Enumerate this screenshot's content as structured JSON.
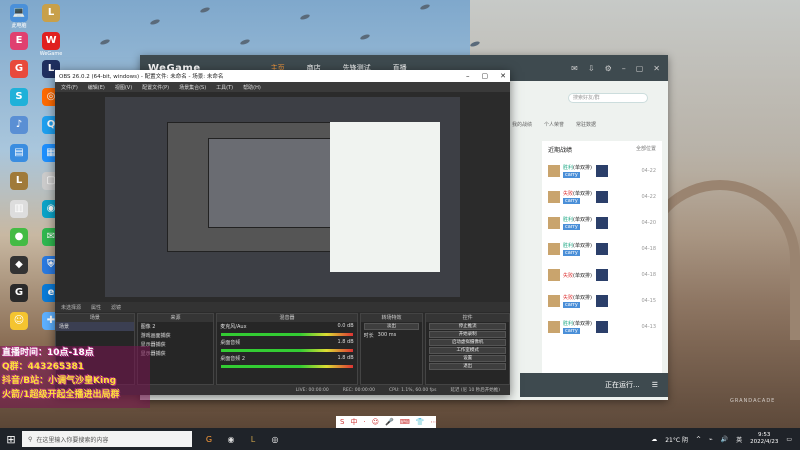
{
  "desktop": {
    "icons": [
      {
        "label": "此电脑",
        "glyph": "💻",
        "color": "#4a90d9"
      },
      {
        "label": "",
        "glyph": "E",
        "color": "#e04070"
      },
      {
        "label": "",
        "glyph": "G",
        "color": "#e84a3b"
      },
      {
        "label": "",
        "glyph": "S",
        "color": "#1fb1d9"
      },
      {
        "label": "",
        "glyph": "♪",
        "color": "#5a8fd4"
      },
      {
        "label": "",
        "glyph": "▤",
        "color": "#3a8de0"
      },
      {
        "label": "",
        "glyph": "L",
        "color": "#a07a3a"
      },
      {
        "label": "",
        "glyph": "▥",
        "color": "#ddd"
      },
      {
        "label": "",
        "glyph": "●",
        "color": "#44bb44"
      },
      {
        "label": "",
        "glyph": "◆",
        "color": "#333"
      },
      {
        "label": "",
        "glyph": "G",
        "color": "#2a2a2a"
      },
      {
        "label": "",
        "glyph": "☺",
        "color": "#f4c430"
      },
      {
        "label": "",
        "glyph": "L",
        "color": "#c8a04a"
      },
      {
        "label": "WeGame",
        "glyph": "W",
        "color": "#e02020"
      },
      {
        "label": "",
        "glyph": "L",
        "color": "#203060"
      },
      {
        "label": "",
        "glyph": "◎",
        "color": "#ff6a00"
      },
      {
        "label": "",
        "glyph": "Q",
        "color": "#1ea0f0"
      },
      {
        "label": "",
        "glyph": "▦",
        "color": "#1e90ff"
      },
      {
        "label": "",
        "glyph": "▢",
        "color": "#ccc"
      },
      {
        "label": "",
        "glyph": "◉",
        "color": "#0aa3c8"
      },
      {
        "label": "",
        "glyph": "✉",
        "color": "#2fb84f"
      },
      {
        "label": "",
        "glyph": "⛨",
        "color": "#2a7ae0"
      },
      {
        "label": "",
        "glyph": "e",
        "color": "#0a7bd8"
      },
      {
        "label": "",
        "glyph": "✚",
        "color": "#5db0ff"
      }
    ]
  },
  "wegame": {
    "logo": "WeGame",
    "nav": [
      "主页",
      "商店",
      "先锋测试",
      "直播"
    ],
    "search_placeholder": "搜索好友/群",
    "tabs": [
      "我的战绩",
      "个人荣誉",
      "常驻数据"
    ],
    "recent_title": "近期战绩",
    "recent_filter": "全部位置",
    "matches": [
      {
        "result": "胜利",
        "mode": "(单双排)",
        "tag": "carry",
        "date": "04-22"
      },
      {
        "result": "失败",
        "mode": "(单双排)",
        "tag": "carry",
        "date": "04-22"
      },
      {
        "result": "胜利",
        "mode": "(单双排)",
        "tag": "carry",
        "date": "04-20"
      },
      {
        "result": "胜利",
        "mode": "(单双排)",
        "tag": "carry",
        "date": "04-18"
      },
      {
        "result": "失败",
        "mode": "(单双排)",
        "tag": "",
        "date": "04-18"
      },
      {
        "result": "失败",
        "mode": "(单双排)",
        "tag": "carry",
        "date": "04-15"
      },
      {
        "result": "胜利",
        "mode": "(单双排)",
        "tag": "carry",
        "date": "04-13"
      }
    ],
    "status": "正在运行..."
  },
  "obs": {
    "title": "OBS 26.0.2 (64-bit, windows) - 配置文件: 未命名 - 场景: 未命名",
    "menu": [
      "文件(F)",
      "编辑(E)",
      "视图(V)",
      "配置文件(P)",
      "场景集合(S)",
      "工具(T)",
      "帮助(H)"
    ],
    "source_bar": [
      "未选择源",
      "属性",
      "滤镜"
    ],
    "dock_titles": [
      "场景",
      "来源",
      "混音器",
      "转场特效",
      "控件"
    ],
    "scenes": [
      "场景"
    ],
    "sources": [
      "图像 2",
      "游戏画面捕获",
      "显示器捕获",
      "显示器捕获"
    ],
    "mixer": [
      {
        "name": "麦克风/Aux",
        "db": "0.0 dB"
      },
      {
        "name": "桌面音频",
        "db": "1.8 dB"
      },
      {
        "name": "桌面音频 2",
        "db": "1.8 dB"
      }
    ],
    "transition": {
      "type": "淡出",
      "label": "时长",
      "duration": "300 ms"
    },
    "controls": [
      "停止推流",
      "开始录制",
      "启动虚拟摄像机",
      "工作室模式",
      "设置",
      "退出"
    ],
    "status": [
      "LIVE: 00:00:00",
      "REC: 00:00:00",
      "CPU: 1.1%, 60.00 fps",
      "延迟 (尼 10 秒后开始推)"
    ]
  },
  "overlay": {
    "line1": "直播时间：10点-18点",
    "line2": "Q群：443265381",
    "line3": "抖音/B站：小调气沙皇King",
    "line4": "火箭/1超级开起全播进出局群"
  },
  "taskbar": {
    "search_placeholder": "在这里输入你要搜索的内容",
    "weather": "21°C 阴",
    "time": "9:53",
    "date": "2022/4/23",
    "lang": "英"
  },
  "ime": {
    "glyphs": [
      "S",
      "中",
      "·",
      "☺",
      "🎤",
      "⌨",
      "👕",
      "⋯"
    ]
  },
  "brand": "GRANDACADE"
}
